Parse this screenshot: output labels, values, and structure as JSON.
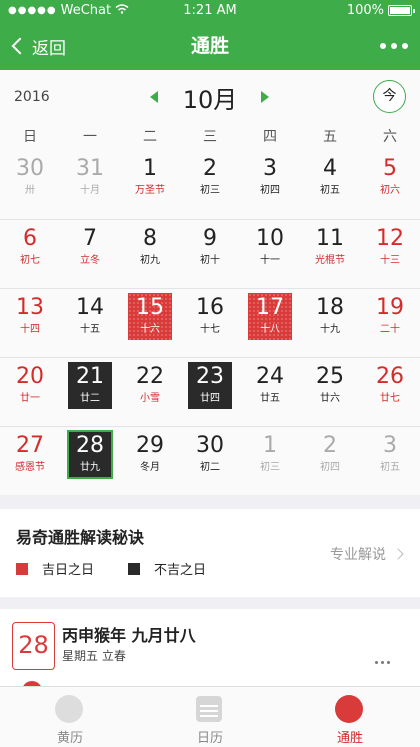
{
  "status_bar": {
    "carrier": "WeChat",
    "time": "1:21 AM",
    "battery": "100%"
  },
  "nav": {
    "back_label": "返回",
    "title": "通胜"
  },
  "calendar": {
    "year": "2016",
    "month": "10月",
    "today_button": "今",
    "weekdays": [
      "日",
      "一",
      "二",
      "三",
      "四",
      "五",
      "六"
    ],
    "weeks": [
      [
        {
          "day": "30",
          "lunar": "卅",
          "style": "gray"
        },
        {
          "day": "31",
          "lunar": "十月",
          "style": "gray"
        },
        {
          "day": "1",
          "lunar": "万圣节",
          "style": "redlunar"
        },
        {
          "day": "2",
          "lunar": "初三",
          "style": "black"
        },
        {
          "day": "3",
          "lunar": "初四",
          "style": "black"
        },
        {
          "day": "4",
          "lunar": "初五",
          "style": "black"
        },
        {
          "day": "5",
          "lunar": "初六",
          "style": "red"
        }
      ],
      [
        {
          "day": "6",
          "lunar": "初七",
          "style": "red"
        },
        {
          "day": "7",
          "lunar": "立冬",
          "style": "redlunar"
        },
        {
          "day": "8",
          "lunar": "初九",
          "style": "black"
        },
        {
          "day": "9",
          "lunar": "初十",
          "style": "black"
        },
        {
          "day": "10",
          "lunar": "十一",
          "style": "black"
        },
        {
          "day": "11",
          "lunar": "光棍节",
          "style": "redlunar"
        },
        {
          "day": "12",
          "lunar": "十三",
          "style": "red"
        }
      ],
      [
        {
          "day": "13",
          "lunar": "十四",
          "style": "red"
        },
        {
          "day": "14",
          "lunar": "十五",
          "style": "black"
        },
        {
          "day": "15",
          "lunar": "十六",
          "style": "good"
        },
        {
          "day": "16",
          "lunar": "十七",
          "style": "black"
        },
        {
          "day": "17",
          "lunar": "十八",
          "style": "good"
        },
        {
          "day": "18",
          "lunar": "十九",
          "style": "black"
        },
        {
          "day": "19",
          "lunar": "二十",
          "style": "red"
        }
      ],
      [
        {
          "day": "20",
          "lunar": "廿一",
          "style": "red"
        },
        {
          "day": "21",
          "lunar": "廿二",
          "style": "bad"
        },
        {
          "day": "22",
          "lunar": "小雪",
          "style": "redlunar"
        },
        {
          "day": "23",
          "lunar": "廿四",
          "style": "bad"
        },
        {
          "day": "24",
          "lunar": "廿五",
          "style": "black"
        },
        {
          "day": "25",
          "lunar": "廿六",
          "style": "black"
        },
        {
          "day": "26",
          "lunar": "廿七",
          "style": "red"
        }
      ],
      [
        {
          "day": "27",
          "lunar": "感恩节",
          "style": "red"
        },
        {
          "day": "28",
          "lunar": "廿九",
          "style": "bad today"
        },
        {
          "day": "29",
          "lunar": "冬月",
          "style": "black"
        },
        {
          "day": "30",
          "lunar": "初二",
          "style": "black"
        },
        {
          "day": "1",
          "lunar": "初三",
          "style": "gray"
        },
        {
          "day": "2",
          "lunar": "初四",
          "style": "gray"
        },
        {
          "day": "3",
          "lunar": "初五",
          "style": "gray"
        }
      ]
    ]
  },
  "legend": {
    "title": "易奇通胜解读秘诀",
    "good_label": "吉日之日",
    "bad_label": "不吉之日",
    "pro_link": "专业解说",
    "good_color": "#d93a3a",
    "bad_color": "#2a2a2a"
  },
  "day_card": {
    "day": "28",
    "line1": "丙申猴年 九月廿八",
    "line2": "星期五  立春"
  },
  "tabs": [
    {
      "label": "黄历",
      "icon": "yin-yang-icon",
      "active": false
    },
    {
      "label": "日历",
      "icon": "calendar-icon",
      "active": false
    },
    {
      "label": "通胜",
      "icon": "tongsheng-icon",
      "active": true
    }
  ],
  "colors": {
    "accent_green": "#3fac4a",
    "red": "#d42b2b"
  }
}
